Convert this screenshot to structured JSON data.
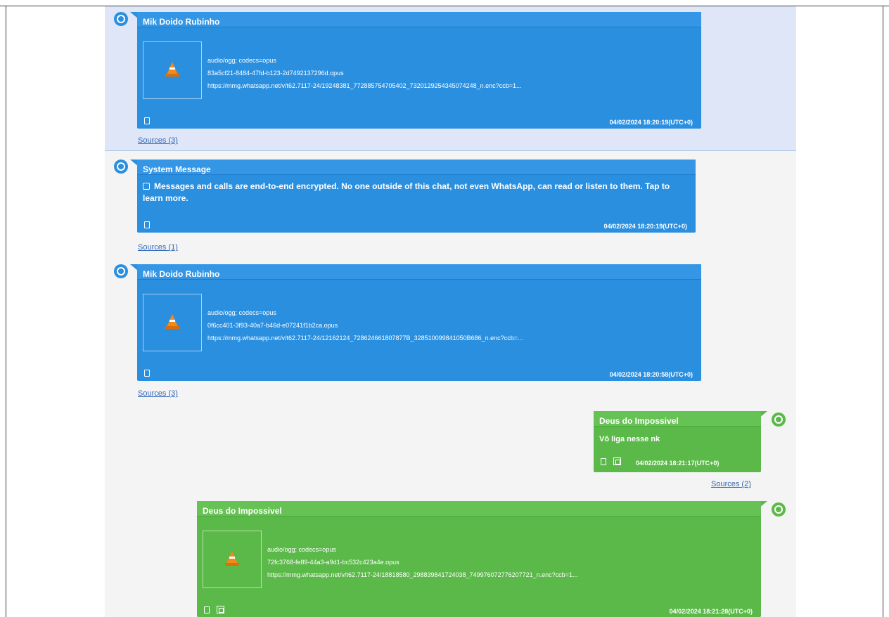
{
  "colors": {
    "blue": "#2b8fe0",
    "green": "#5bb949",
    "highlight": "#dfe6f7",
    "link": "#2f67b8"
  },
  "messages": [
    {
      "sender": "Mik Doido Rubinho",
      "media": {
        "type": "audio/ogg; codecs=opus",
        "filename": "83a5cf21-8484-47fd-b123-2d7492137296d.opus",
        "url": "https://mmg.whatsapp.net/v/t62.7117-24/19248381_772885754705402_7320129254345074248_n.enc?ccb=1..."
      },
      "icon": "vlc-cone-icon",
      "timestamp": "04/02/2024 18:20:19(UTC+0)",
      "sources": "Sources (3)"
    },
    {
      "sender": "System Message",
      "text": "Messages and calls are end-to-end encrypted. No one outside of this chat, not even WhatsApp, can read or listen to them. Tap to learn more.",
      "timestamp": "04/02/2024 18:20:19(UTC+0)",
      "sources": "Sources (1)"
    },
    {
      "sender": "Mik Doido Rubinho",
      "media": {
        "type": "audio/ogg; codecs=opus",
        "filename": "0f6cc401-3f93-40a7-b46d-e07241f1b2ca.opus",
        "url": "https://mmg.whatsapp.net/v/t62.7117-24/12162124_728624661807877B_328510099841050B686_n.enc?ccb=..."
      },
      "icon": "vlc-cone-icon",
      "timestamp": "04/02/2024 18:20:58(UTC+0)",
      "sources": "Sources (3)"
    },
    {
      "sender": "Deus do Impossivel",
      "text": "Vô liga nesse nk",
      "timestamp": "04/02/2024 18:21:17(UTC+0)",
      "sources": "Sources (2)"
    },
    {
      "sender": "Deus do Impossivel",
      "media": {
        "type": "audio/ogg; codecs=opus",
        "filename": "72fc3768-fe89-44a3-a9d1-bc532c423a4e.opus",
        "url": "https://mmg.whatsapp.net/v/t62.7117-24/18818580_298839841724038_749976072776207721_n.enc?ccb=1..."
      },
      "icon": "vlc-cone-icon",
      "timestamp": "04/02/2024 18:21:28(UTC+0)"
    }
  ]
}
